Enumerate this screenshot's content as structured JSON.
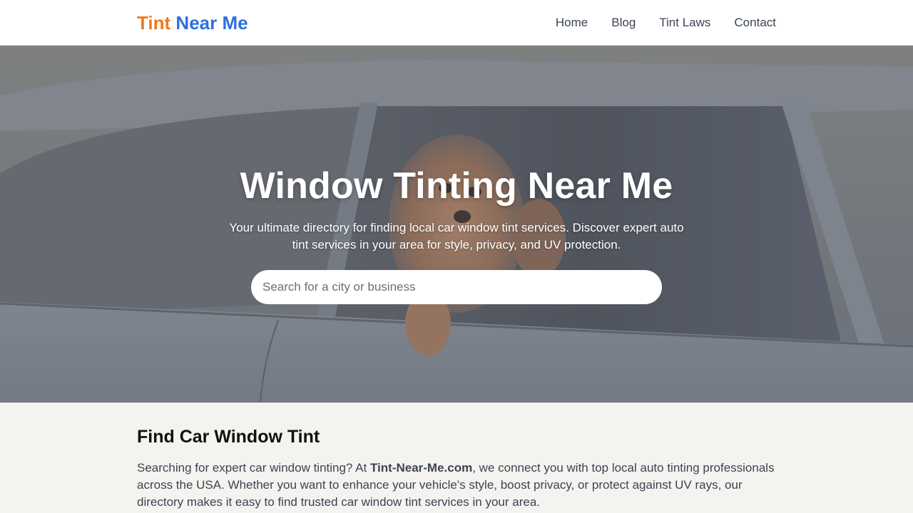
{
  "header": {
    "logo_part1": "Tint",
    "logo_part2": "Near Me",
    "nav": {
      "home": "Home",
      "blog": "Blog",
      "tint_laws": "Tint Laws",
      "contact": "Contact"
    }
  },
  "hero": {
    "title": "Window Tinting Near Me",
    "subtitle": "Your ultimate directory for finding local car window tint services. Discover expert auto tint services in your area for style, privacy, and UV protection.",
    "search_placeholder": "Search for a city or business"
  },
  "main": {
    "heading": "Find Car Window Tint",
    "intro_prefix": "Searching for expert car window tinting? At ",
    "intro_brand": "Tint-Near-Me.com",
    "intro_suffix": ", we connect you with top local auto tinting professionals across the USA. Whether you want to enhance your vehicle's style, boost privacy, or protect against UV rays, our directory makes it easy to find trusted car window tint services in your area."
  },
  "colors": {
    "logo_orange": "#f07a1c",
    "logo_blue": "#2f6fdd",
    "nav_text": "#3a4454",
    "page_background": "#f4f3ef"
  },
  "icons": {
    "hero_image": "dog-in-car-window-photo"
  }
}
